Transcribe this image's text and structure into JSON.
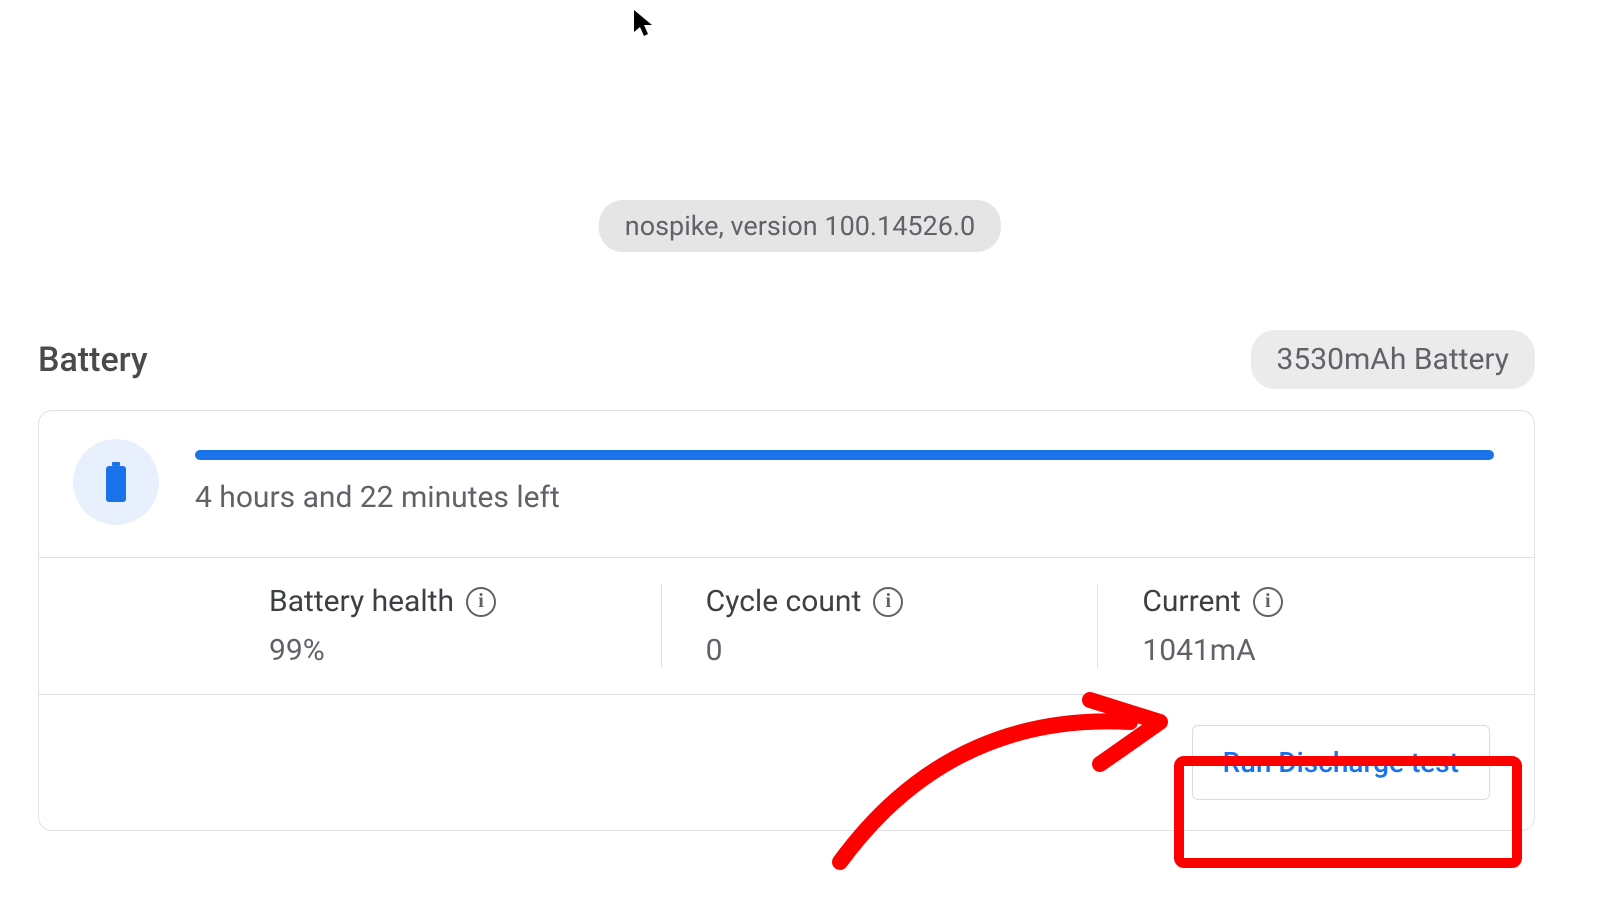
{
  "version_badge": "nospike, version 100.14526.0",
  "section": {
    "title": "Battery",
    "capacity": "3530mAh Battery"
  },
  "battery": {
    "time_left": "4 hours and 22 minutes left",
    "progress_percent": 99,
    "stats": {
      "health": {
        "label": "Battery health",
        "value": "99%"
      },
      "cycle": {
        "label": "Cycle count",
        "value": "0"
      },
      "current": {
        "label": "Current",
        "value": "1041mA"
      }
    },
    "discharge_button": "Run Discharge test"
  }
}
